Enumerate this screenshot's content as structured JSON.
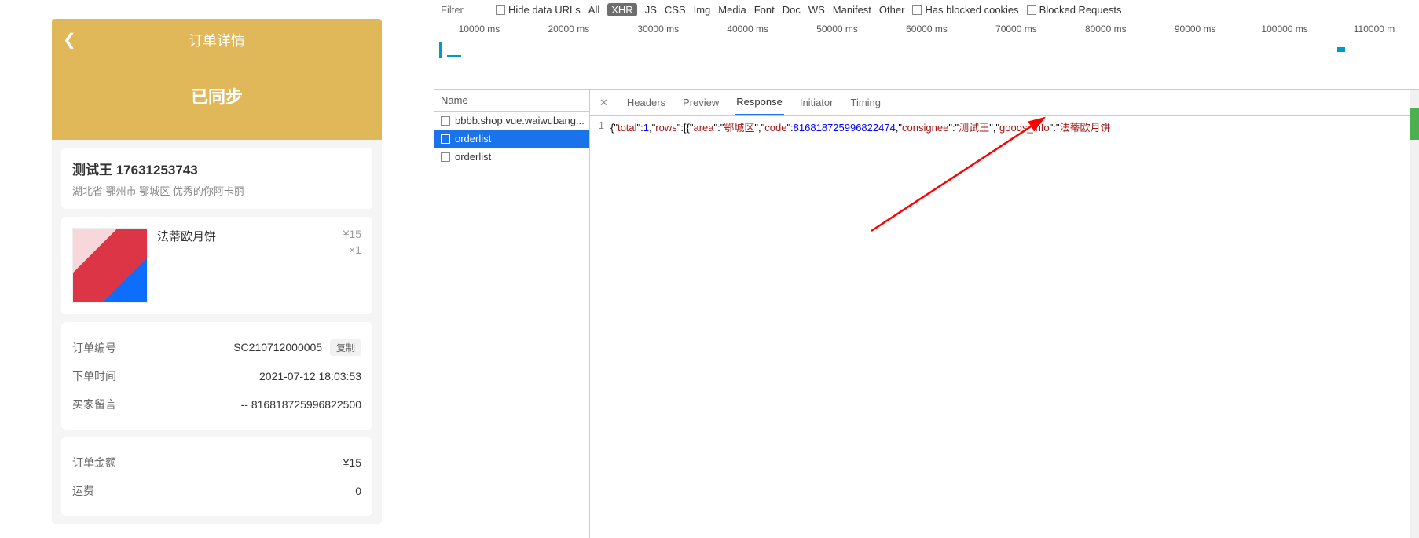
{
  "mobile": {
    "title": "订单详情",
    "status": "已同步",
    "addr": {
      "name": "测试王 17631253743",
      "full": "湖北省 鄂州市 鄂城区 优秀的你阿卡丽"
    },
    "product": {
      "name": "法蒂欧月饼",
      "price": "¥15",
      "qty": "×1"
    },
    "order": {
      "no_label": "订单编号",
      "no_value": "SC210712000005",
      "copy": "复制",
      "time_label": "下单时间",
      "time_value": "2021-07-12 18:03:53",
      "msg_label": "买家留言",
      "msg_value": "-- 816818725996822500"
    },
    "total": {
      "amount_label": "订单金额",
      "amount_value": "¥15",
      "ship_label": "运费",
      "ship_value": "0"
    }
  },
  "devtools": {
    "filter_placeholder": "Filter",
    "hide_data_urls": "Hide data URLs",
    "types": {
      "all": "All",
      "xhr": "XHR",
      "js": "JS",
      "css": "CSS",
      "img": "Img",
      "media": "Media",
      "font": "Font",
      "doc": "Doc",
      "ws": "WS",
      "manifest": "Manifest",
      "other": "Other"
    },
    "has_blocked": "Has blocked cookies",
    "blocked_req": "Blocked Requests",
    "timeline": [
      "10000 ms",
      "20000 ms",
      "30000 ms",
      "40000 ms",
      "50000 ms",
      "60000 ms",
      "70000 ms",
      "80000 ms",
      "90000 ms",
      "100000 ms",
      "110000 m"
    ],
    "name_header": "Name",
    "requests": [
      "bbbb.shop.vue.waiwubang...",
      "orderlist",
      "orderlist"
    ],
    "tabs": {
      "headers": "Headers",
      "preview": "Preview",
      "response": "Response",
      "initiator": "Initiator",
      "timing": "Timing"
    },
    "response": {
      "line": "1",
      "parts": {
        "p1": "{\"",
        "k1": "total",
        "p2": "\":",
        "v1": "1",
        "p3": ",\"",
        "k2": "rows",
        "p4": "\":[{\"",
        "k3": "area",
        "p5": "\":\"",
        "v3": "鄂城区",
        "p6": "\",\"",
        "k4": "code",
        "p7": "\":",
        "v4": "816818725996822474",
        "p8": ",\"",
        "k5": "consignee",
        "p9": "\":\"",
        "v5": "测试王",
        "p10": "\",\"",
        "k6": "goods_info",
        "p11": "\":\"",
        "v6": "法蒂欧月饼"
      }
    }
  }
}
